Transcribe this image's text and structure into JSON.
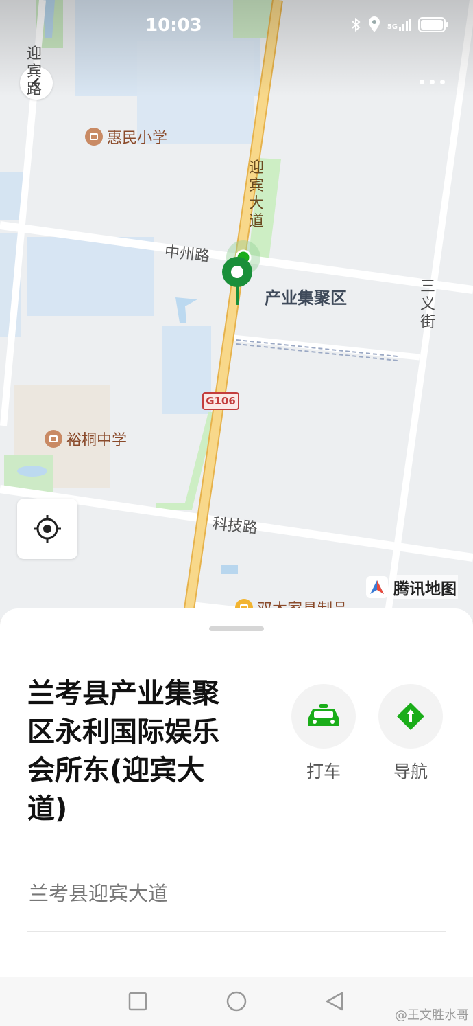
{
  "status_bar": {
    "time": "10:03",
    "network": "5G"
  },
  "map": {
    "roads": {
      "yingbin_avenue": "迎宾大道",
      "zhongzhou_road": "中州路",
      "keji_road": "科技路",
      "sanyi_street": "三义街",
      "yingbin_road_top": "迎宾路",
      "g106": "G106"
    },
    "pois": {
      "huimin_school": "惠民小学",
      "yutong_school": "裕桐中学",
      "furniture": "双木家具制品"
    },
    "area_label": "产业集聚区",
    "brand": "腾讯地图"
  },
  "place": {
    "title": "兰考县产业集聚区永利国际娱乐会所东(迎宾大道)",
    "address": "兰考县迎宾大道"
  },
  "actions": {
    "taxi_label": "打车",
    "navigate_label": "导航"
  },
  "watermark": "@王文胜水哥",
  "colors": {
    "accent_green": "#1aad19",
    "road_yellow": "#f6d27a",
    "water_blue": "#cfe3f5",
    "park_green": "#cdeec4"
  }
}
